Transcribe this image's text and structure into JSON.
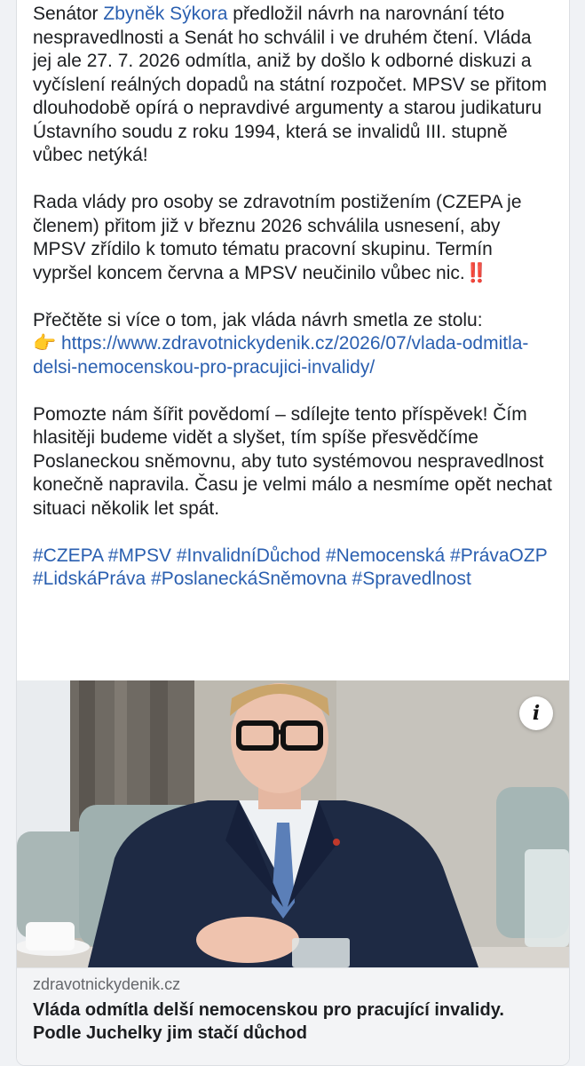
{
  "post": {
    "p1_before": "Senátor ",
    "p1_link": "Zbyněk Sýkora",
    "p1_after": " předložil návrh na narovnání této nespravedlnosti a Senát ho schválil i ve druhém čtení. Vláda jej ale 27. 7. 2026 odmítla, aniž by došlo k odborné diskuzi a vyčíslení reálných dopadů na státní rozpočet. MPSV se přitom dlouhodobě opírá o nepravdivé argumenty a starou judikaturu Ústavního soudu z roku 1994, která se invalidů III. stupně vůbec netýká!",
    "p2": "Rada vlády pro osoby se zdravotním postižením (CZEPA je členem) přitom již v březnu 2026 schválila usnesení, aby MPSV zřídilo k tomuto tématu pracovní skupinu. Termín vypršel koncem června a MPSV neučinilo vůbec nic.",
    "p2_emoji": "‼️",
    "p3": "Přečtěte si více o tom, jak vláda návrh smetla ze stolu:",
    "p3_emoji": "👉",
    "p3_link": "https://www.zdravotnickydenik.cz/2026/07/vlada-odmitla-delsi-nemocenskou-pro-pracujici-invalidy/",
    "p4": "Pomozte nám šířit povědomí – sdílejte tento příspěvek! Čím hlasitěji budeme vidět a slyšet, tím spíše přesvědčíme Poslaneckou sněmovnu, aby tuto systémovou nespravedlnost konečně napravila. Času je velmi málo a nesmíme opět nechat situaci několik let spát.",
    "hashtags": "#CZEPA #MPSV #InvalidníDůchod #Nemocenská #PrávaOZP #LidskáPráva #PoslaneckáSněmovna #Spravedlnost"
  },
  "link_preview": {
    "info_icon": "info-icon",
    "info_glyph": "i",
    "domain": "zdravotnickydenik.cz",
    "headline": "Vláda odmítla delší nemocenskou pro pracující invalidy. Podle Juchelky jim stačí důchod"
  },
  "colors": {
    "link": "#2a5fb0",
    "text": "#1c1e21",
    "muted": "#65676b",
    "background": "#f0f2f5"
  }
}
